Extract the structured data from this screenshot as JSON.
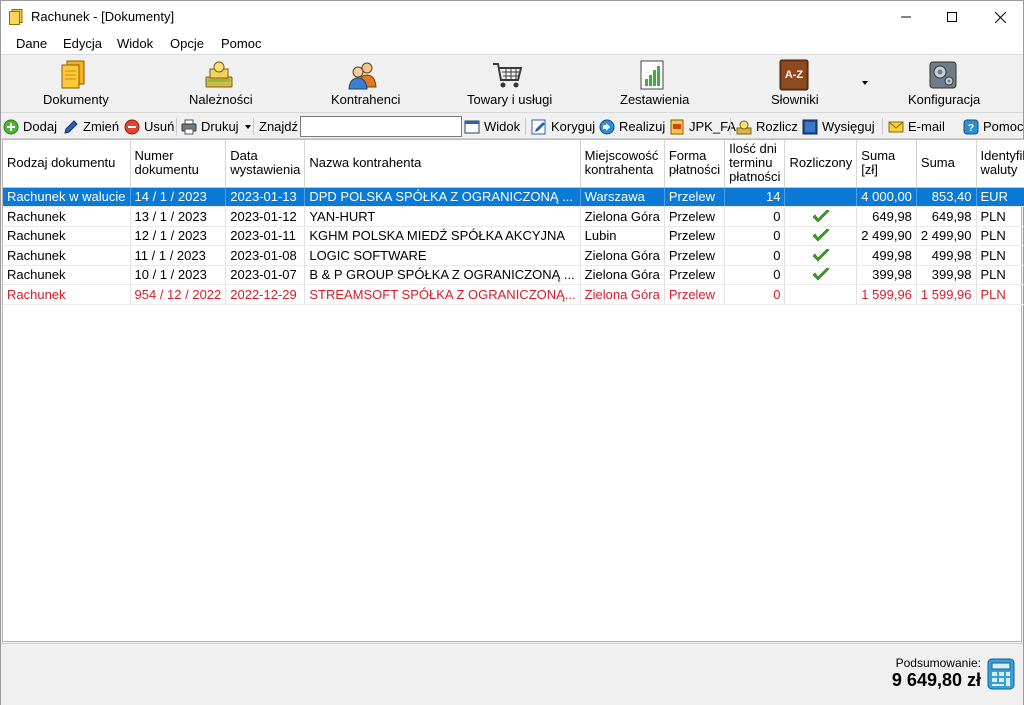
{
  "window": {
    "title": "Rachunek - [Dokumenty]"
  },
  "menu": [
    "Dane",
    "Edycja",
    "Widok",
    "Opcje",
    "Pomoc"
  ],
  "big_toolbar": {
    "dokumenty": "Dokumenty",
    "naleznosci": "Należności",
    "kontrahenci": "Kontrahenci",
    "towary": "Towary i usługi",
    "zestawienia": "Zestawienia",
    "slowniki": "Słowniki",
    "konfiguracja": "Konfiguracja",
    "slowniki_icon_text": "A-Z"
  },
  "small_toolbar": {
    "dodaj": "Dodaj",
    "zmien": "Zmień",
    "usun": "Usuń",
    "drukuj": "Drukuj",
    "znajdz": "Znajdź",
    "search_value": "",
    "widok": "Widok",
    "koryguj": "Koryguj",
    "realizuj": "Realizuj",
    "jpk": "JPK_FA",
    "rozlicz": "Rozlicz",
    "wysiegnij": "Wysięguj",
    "email": "E-mail",
    "pomoc": "Pomoc"
  },
  "table": {
    "headers": {
      "rodzaj": "Rodzaj dokumentu",
      "numer": "Numer dokumentu",
      "data": "Data wystawienia",
      "nazwa": "Nazwa kontrahenta",
      "miejsc": "Miejscowość kontrahenta",
      "forma": "Forma płatności",
      "ilosc": "Ilość dni terminu płatności",
      "rozl": "Rozliczony",
      "sumazl": "Suma [zł]",
      "suma": "Suma",
      "waluta": "Identyfikator waluty"
    },
    "rows": [
      {
        "rodzaj": "Rachunek w walucie",
        "numer": "14 / 1 / 2023",
        "data": "2023-01-13",
        "nazwa": "DPD POLSKA SPÓŁKA Z OGRANICZONĄ ...",
        "miejsc": "Warszawa",
        "forma": "Przelew",
        "ilosc": "14",
        "rozliczony": false,
        "sumazl": "4 000,00",
        "suma": "853,40",
        "waluta": "EUR"
      },
      {
        "rodzaj": "Rachunek",
        "numer": "13 / 1 / 2023",
        "data": "2023-01-12",
        "nazwa": "YAN-HURT",
        "miejsc": "Zielona Góra",
        "forma": "Przelew",
        "ilosc": "0",
        "rozliczony": true,
        "sumazl": "649,98",
        "suma": "649,98",
        "waluta": "PLN"
      },
      {
        "rodzaj": "Rachunek",
        "numer": "12 / 1 / 2023",
        "data": "2023-01-11",
        "nazwa": "KGHM POLSKA MIEDŹ SPÓŁKA AKCYJNA",
        "miejsc": "Lubin",
        "forma": "Przelew",
        "ilosc": "0",
        "rozliczony": true,
        "sumazl": "2 499,90",
        "suma": "2 499,90",
        "waluta": "PLN"
      },
      {
        "rodzaj": "Rachunek",
        "numer": "11 / 1 / 2023",
        "data": "2023-01-08",
        "nazwa": "LOGIC SOFTWARE",
        "miejsc": "Zielona Góra",
        "forma": "Przelew",
        "ilosc": "0",
        "rozliczony": true,
        "sumazl": "499,98",
        "suma": "499,98",
        "waluta": "PLN"
      },
      {
        "rodzaj": "Rachunek",
        "numer": "10 / 1 / 2023",
        "data": "2023-01-07",
        "nazwa": "B & P GROUP SPÓŁKA Z OGRANICZONĄ ...",
        "miejsc": "Zielona Góra",
        "forma": "Przelew",
        "ilosc": "0",
        "rozliczony": true,
        "sumazl": "399,98",
        "suma": "399,98",
        "waluta": "PLN"
      },
      {
        "rodzaj": "Rachunek",
        "numer": "954 / 12 / 2022",
        "data": "2022-12-29",
        "nazwa": "STREAMSOFT SPÓŁKA Z OGRANICZONĄ...",
        "miejsc": "Zielona Góra",
        "forma": "Przelew",
        "ilosc": "0",
        "rozliczony": false,
        "sumazl": "1 599,96",
        "suma": "1 599,96",
        "waluta": "PLN"
      }
    ]
  },
  "summary": {
    "label": "Podsumowanie:",
    "value": "9 649,80 zł"
  },
  "colors": {
    "selection": "#0a7ad6",
    "overdue": "#d41c2a",
    "check": "#3aa61f"
  }
}
